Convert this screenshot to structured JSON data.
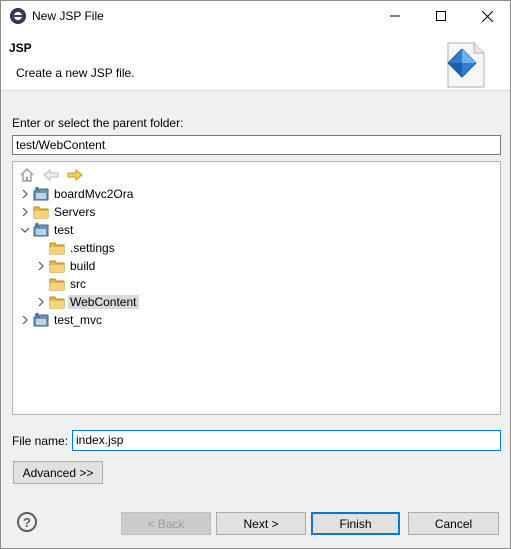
{
  "window": {
    "title": "New JSP File"
  },
  "header": {
    "title": "JSP",
    "description": "Create a new JSP file."
  },
  "folder": {
    "prompt": "Enter or select the parent folder:",
    "value": "test/WebContent"
  },
  "tree": {
    "items": [
      {
        "label": "boardMvc2Ora",
        "type": "project",
        "expander": "collapsed"
      },
      {
        "label": "Servers",
        "type": "folder",
        "expander": "collapsed"
      },
      {
        "label": "test",
        "type": "project",
        "expander": "expanded"
      },
      {
        "label": ".settings",
        "type": "folder",
        "expander": "none"
      },
      {
        "label": "build",
        "type": "folder",
        "expander": "collapsed"
      },
      {
        "label": "src",
        "type": "folder",
        "expander": "none"
      },
      {
        "label": "WebContent",
        "type": "folder",
        "expander": "collapsed",
        "selected": true
      },
      {
        "label": "test_mvc",
        "type": "project",
        "expander": "collapsed"
      }
    ]
  },
  "file_name": {
    "label": "File name:",
    "value": "index.jsp"
  },
  "buttons": {
    "advanced": "Advanced >>",
    "back": "< Back",
    "next": "Next >",
    "finish": "Finish",
    "cancel": "Cancel"
  },
  "icons": {
    "app": "eclipse-icon",
    "header": "jsp-wizard-icon",
    "help": "help-icon"
  },
  "colors": {
    "accent": "#0078d7",
    "folder": "#e8b64a",
    "selection": "#d9d9d9"
  }
}
